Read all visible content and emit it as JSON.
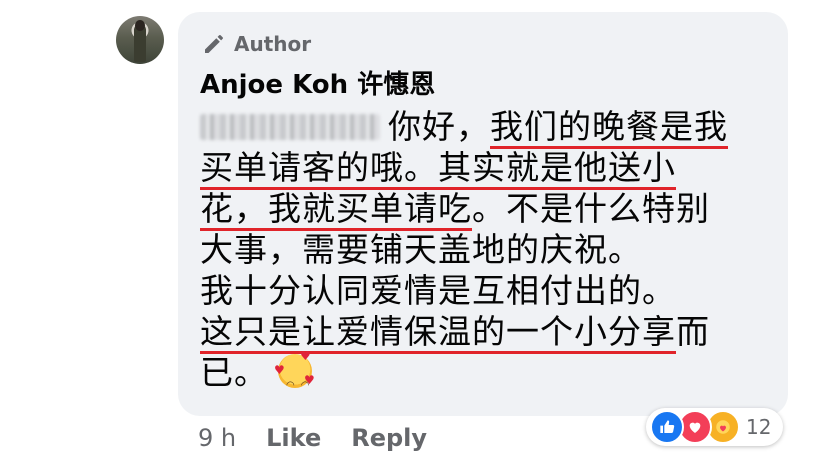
{
  "comment": {
    "author_badge": "Author",
    "author_name": "Anjoe Koh 许憓恩",
    "lines": [
      {
        "prefix": "你好，",
        "underlined": "我们的晚餐是我"
      },
      {
        "underlined": "买单请客的哦。",
        "rest": "其实就是他送小"
      },
      {
        "underlined": "花，我就买单请吃",
        "rest": "。不是什么特别"
      },
      {
        "plain": "大事，需要铺天盖地的庆祝。"
      },
      {
        "plain": "我十分认同爱情是互相付出的。"
      },
      {
        "underlined": "这只是让爱情保温的一个小分享",
        "rest": "而"
      },
      {
        "plain": "已。"
      }
    ]
  },
  "actions": {
    "time": "9 h",
    "like": "Like",
    "reply": "Reply"
  },
  "reactions": {
    "types": [
      "like-icon",
      "love-icon",
      "care-icon"
    ],
    "count": "12"
  },
  "colors": {
    "bubble": "#f0f2f5",
    "underline": "#e0242a",
    "like": "#1877f2",
    "love": "#f33e58"
  }
}
